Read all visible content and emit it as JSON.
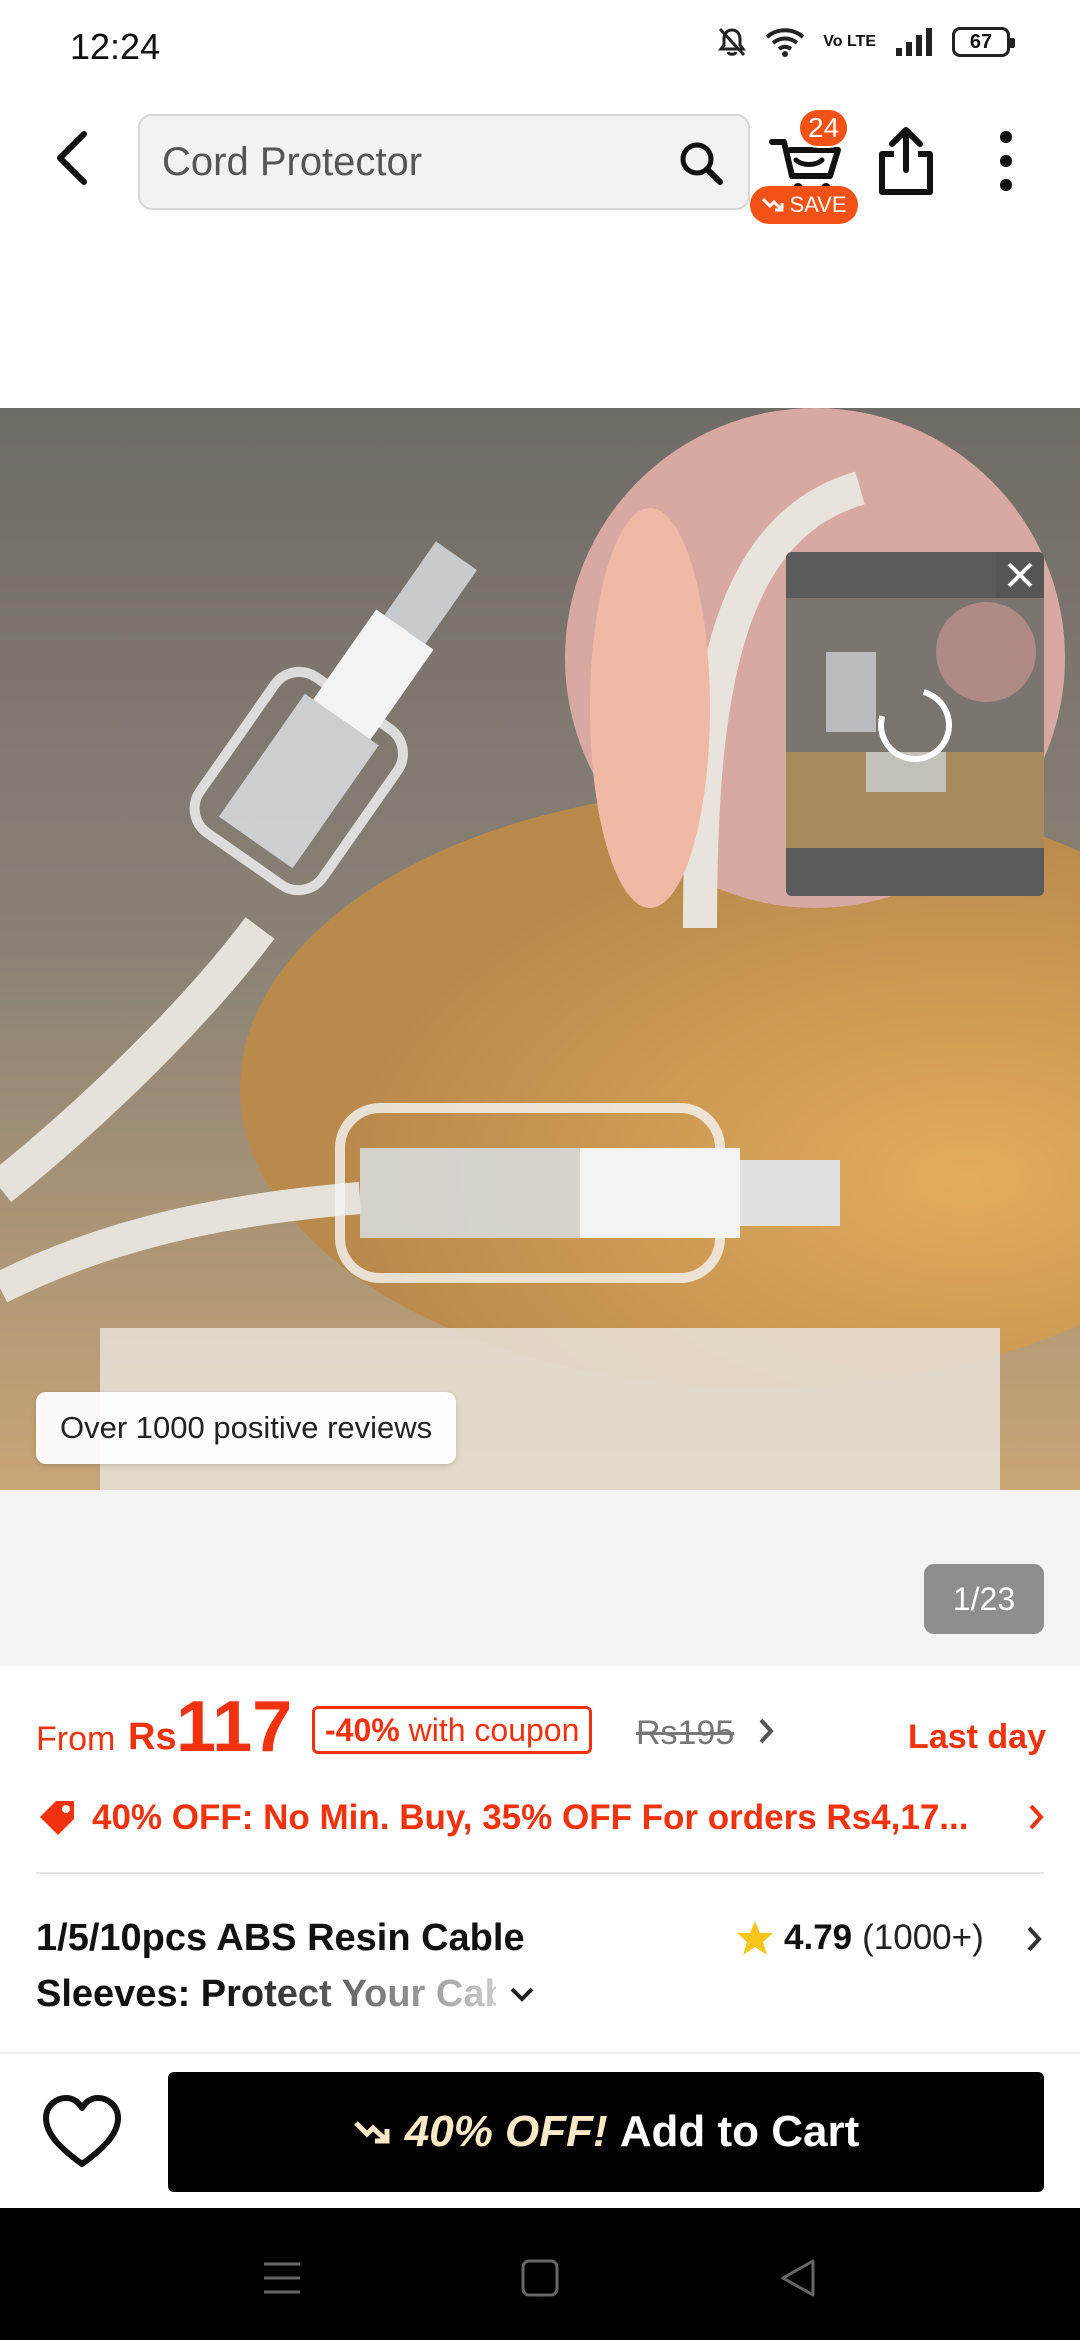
{
  "status_bar": {
    "time": "12:24",
    "lte_label": "Vo LTE",
    "battery": "67",
    "icons": [
      "mute-bell-icon",
      "wifi-icon",
      "volte-icon",
      "signal-icon",
      "battery-icon"
    ]
  },
  "nav": {
    "search_placeholder": "Cord Protector",
    "cart_count": "24",
    "save_label": "SAVE",
    "icons": [
      "back-arrow-icon",
      "search-icon",
      "cart-icon",
      "share-icon",
      "more-vertical-icon"
    ]
  },
  "product_image": {
    "reviews_chip": "Over 1000 positive reviews",
    "page_counter": "1/23"
  },
  "price": {
    "from_label": "From",
    "currency": "Rs",
    "value": "117",
    "coupon_discount": "-40%",
    "coupon_text": "with coupon",
    "original_price": "Rs195",
    "deadline": "Last day"
  },
  "promo": {
    "text": "40% OFF: No Min. Buy,  35% OFF For orders Rs4,17..."
  },
  "product": {
    "title_line1": "1/5/10pcs ABS Resin Cable",
    "title_line2": "Sleeves: Protect Your Cables Fro.",
    "rating": "4.79",
    "rating_count": "(1000+)"
  },
  "bottom_bar": {
    "discount_label": "40% OFF!",
    "add_to_cart_label": "Add to Cart"
  },
  "colors": {
    "accent": "#f0320f",
    "badge": "#f35116",
    "star": "#f5c518",
    "cta_background": "#000000"
  }
}
